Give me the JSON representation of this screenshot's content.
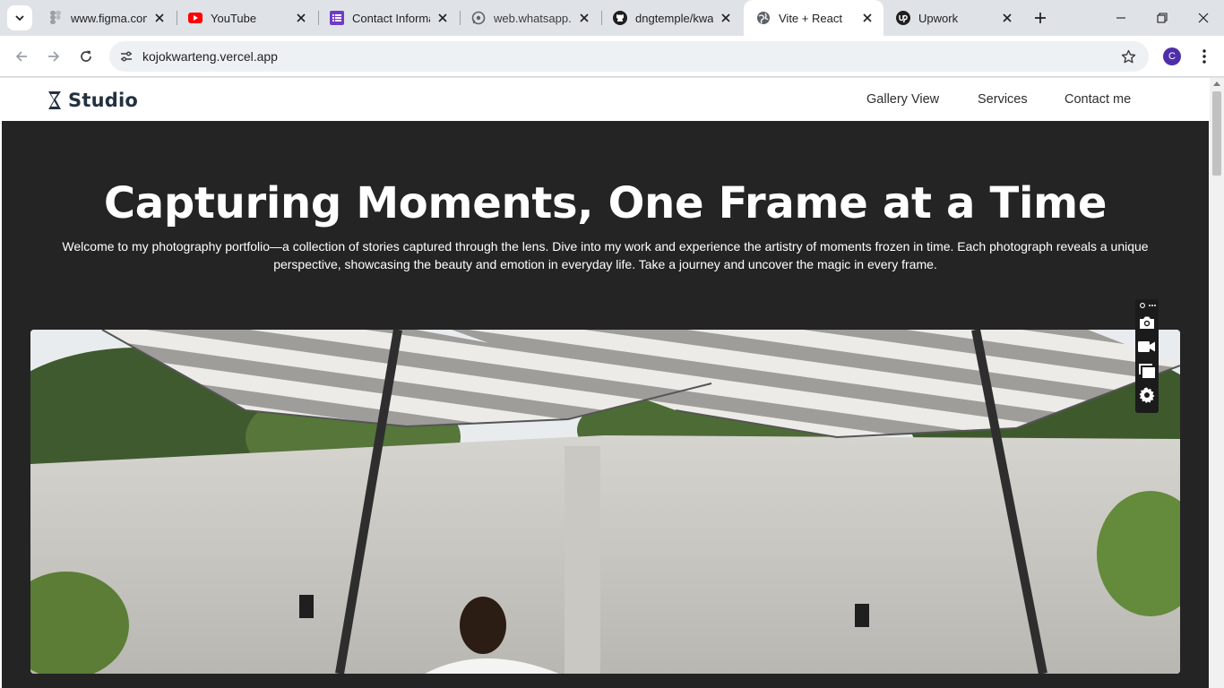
{
  "browser": {
    "tabs": [
      {
        "title": "www.figma.com",
        "favicon": "figma-icon"
      },
      {
        "title": "YouTube",
        "favicon": "youtube-icon"
      },
      {
        "title": "Contact Informa",
        "favicon": "forms-icon"
      },
      {
        "title": "web.whatsapp.co",
        "favicon": "whatsapp-icon"
      },
      {
        "title": "dngtemple/kwar",
        "favicon": "github-icon"
      },
      {
        "title": "Vite + React",
        "favicon": "globe-icon",
        "active": true
      },
      {
        "title": "Upwork",
        "favicon": "upwork-icon"
      }
    ],
    "url": "kojokwarteng.vercel.app",
    "profile_initial": "C"
  },
  "site": {
    "logo_text": "Studio",
    "nav": [
      "Gallery View",
      "Services",
      "Contact me"
    ],
    "hero_title": "Capturing Moments, One Frame at a Time",
    "hero_text": "Welcome to my photography portfolio—a collection of stories captured through the lens. Dive into my work and experience the artistry of moments frozen in time. Each photograph reveals a unique perspective, showcasing the beauty and emotion in everyday life. Take a journey and uncover the magic in every frame."
  },
  "capture_toolbar": {
    "items": [
      "screenshot-icon",
      "video-record-icon",
      "gallery-icon",
      "settings-icon"
    ]
  },
  "colors": {
    "hero_bg": "#242424",
    "logo": "#233140",
    "tab_strip": "#dfe3e8",
    "profile": "#4e2fa8"
  }
}
